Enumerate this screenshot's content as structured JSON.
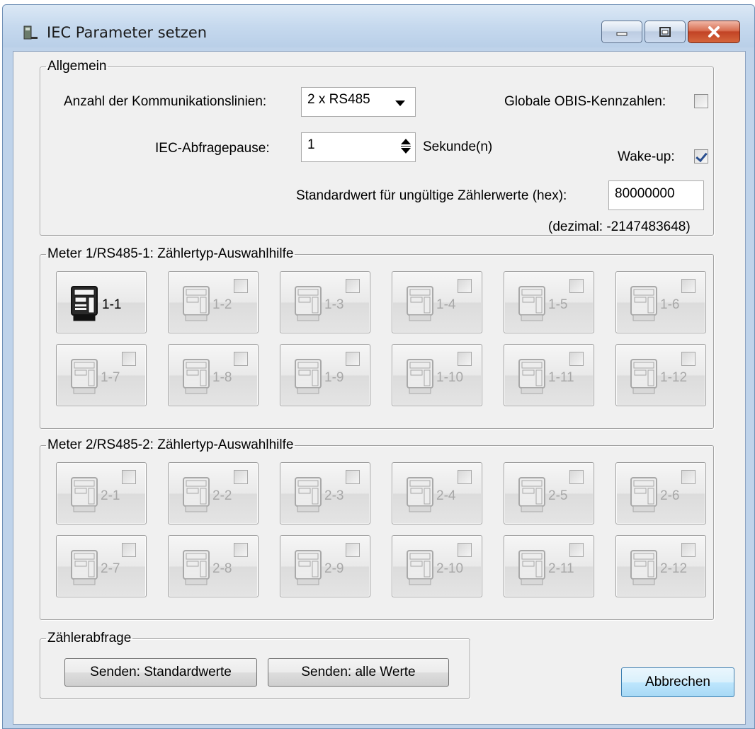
{
  "window": {
    "title": "IEC Parameter setzen"
  },
  "general": {
    "legend": "Allgemein",
    "comm_lines_label": "Anzahl der Kommunikationslinien:",
    "comm_lines_value": "2 x RS485",
    "global_obis_label": "Globale OBIS-Kennzahlen:",
    "global_obis_checked": false,
    "poll_pause_label": "IEC-Abfragepause:",
    "poll_pause_value": "1",
    "poll_pause_unit": "Sekunde(n)",
    "wakeup_label": "Wake-up:",
    "wakeup_checked": true,
    "invalid_default_label": "Standardwert für ungültige Zählerwerte (hex):",
    "invalid_default_value": "80000000",
    "decimal_note": "(dezimal: -2147483648)"
  },
  "meter1": {
    "legend": "Meter 1/RS485-1: Zählertyp-Auswahlhilfe",
    "buttons": [
      {
        "label": "1-1",
        "active": true
      },
      {
        "label": "1-2",
        "active": false
      },
      {
        "label": "1-3",
        "active": false
      },
      {
        "label": "1-4",
        "active": false
      },
      {
        "label": "1-5",
        "active": false
      },
      {
        "label": "1-6",
        "active": false
      },
      {
        "label": "1-7",
        "active": false
      },
      {
        "label": "1-8",
        "active": false
      },
      {
        "label": "1-9",
        "active": false
      },
      {
        "label": "1-10",
        "active": false
      },
      {
        "label": "1-11",
        "active": false
      },
      {
        "label": "1-12",
        "active": false
      }
    ]
  },
  "meter2": {
    "legend": "Meter 2/RS485-2: Zählertyp-Auswahlhilfe",
    "buttons": [
      {
        "label": "2-1",
        "active": false
      },
      {
        "label": "2-2",
        "active": false
      },
      {
        "label": "2-3",
        "active": false
      },
      {
        "label": "2-4",
        "active": false
      },
      {
        "label": "2-5",
        "active": false
      },
      {
        "label": "2-6",
        "active": false
      },
      {
        "label": "2-7",
        "active": false
      },
      {
        "label": "2-8",
        "active": false
      },
      {
        "label": "2-9",
        "active": false
      },
      {
        "label": "2-10",
        "active": false
      },
      {
        "label": "2-11",
        "active": false
      },
      {
        "label": "2-12",
        "active": false
      }
    ]
  },
  "query": {
    "legend": "Zählerabfrage",
    "send_defaults_label": "Senden: Standardwerte",
    "send_all_label": "Senden: alle Werte"
  },
  "cancel_label": "Abbrechen",
  "colors": {
    "dialog_bg": "#f0f0f0",
    "titlebar": "#c6d9ee",
    "close_button": "#c24325",
    "disabled_text": "#a8a8a8",
    "checkbox_check": "#2a4f8f"
  }
}
